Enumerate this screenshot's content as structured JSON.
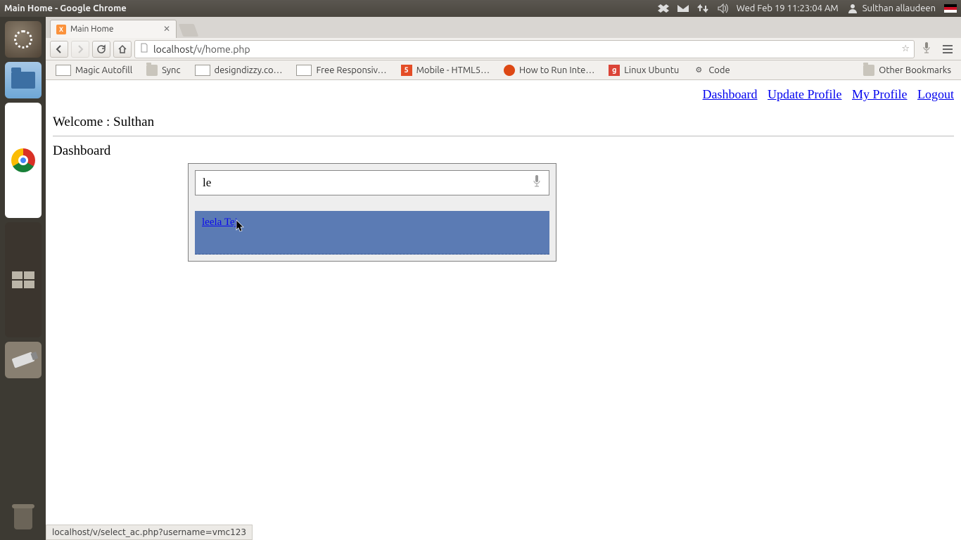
{
  "sysbar": {
    "window_title": "Main Home - Google Chrome",
    "datetime": "Wed Feb 19 11:23:04 AM",
    "user": "Sulthan allaudeen"
  },
  "tab": {
    "title": "Main Home"
  },
  "urlbar": {
    "host": "localhost",
    "path": "/v/home.php"
  },
  "bookmarks": {
    "items": [
      {
        "label": "Magic Autofill",
        "icon": "page"
      },
      {
        "label": "Sync",
        "icon": "folder"
      },
      {
        "label": "designdizzy.co…",
        "icon": "page"
      },
      {
        "label": "Free Responsiv…",
        "icon": "page"
      },
      {
        "label": "Mobile - HTML5…",
        "icon": "html5"
      },
      {
        "label": "How to Run Inte…",
        "icon": "ubuntu"
      },
      {
        "label": "Linux Ubuntu",
        "icon": "gplus"
      },
      {
        "label": "Code",
        "icon": "gear"
      }
    ],
    "other": "Other Bookmarks"
  },
  "page": {
    "nav": {
      "dashboard": "Dashboard",
      "update_profile": "Update Profile",
      "my_profile": "My Profile",
      "logout": "Logout"
    },
    "welcome": "Welcome : Sulthan",
    "section": "Dashboard",
    "search_value": "le",
    "suggestion": "leela Tej"
  },
  "status": "localhost/v/select_ac.php?username=vmc123"
}
